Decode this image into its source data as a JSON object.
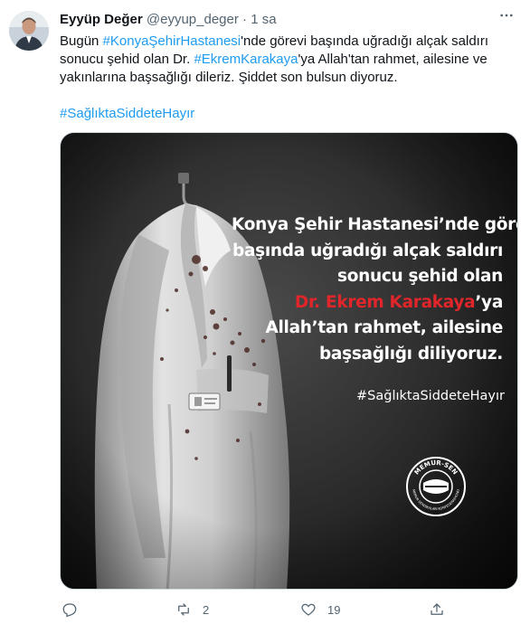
{
  "tweet": {
    "author_name": "Eyyüp Değer",
    "author_handle": "@eyyup_deger",
    "separator": "·",
    "time": "1 sa",
    "more_icon": "more-horizontal-icon",
    "text_segments": [
      {
        "text": "Bugün ",
        "type": "text"
      },
      {
        "text": "#KonyaŞehirHastanesi",
        "type": "hashtag"
      },
      {
        "text": "'nde görevi başında uğradığı alçak saldırı sonucu şehid olan Dr. ",
        "type": "text"
      },
      {
        "text": "#EkremKarakaya",
        "type": "hashtag"
      },
      {
        "text": "'ya Allah'tan rahmet, ailesine ve yakınlarına başsağlığı dileriz. Şiddet son bulsun diyoruz.",
        "type": "text"
      }
    ],
    "hashtag_line": "#SağlıktaSiddeteHayır"
  },
  "image": {
    "lines": [
      "Konya Şehir Hastanesi’nde görevi",
      "başında uğradığı alçak saldırı",
      "sonucu şehid olan"
    ],
    "line_highlight_name": "Dr. Ekrem Karakaya",
    "line_highlight_suffix": "’ya",
    "line_5": "Allah’tan rahmet, ailesine",
    "line_6": "başsağlığı diliyoruz.",
    "hashtag": "#SağlıktaSiddeteHayır",
    "logo_text": "MEMUR-SEN",
    "logo_subtext": "MEMUR SENDİKALARI KONFEDERASYONU",
    "accent_red": "#e0262a"
  },
  "actions": {
    "reply_icon": "reply-icon",
    "reply_count": "",
    "retweet_icon": "retweet-icon",
    "retweet_count": "2",
    "like_icon": "heart-icon",
    "like_count": "19",
    "share_icon": "share-icon"
  },
  "colors": {
    "link": "#1d9bf0",
    "secondary_text": "#536471",
    "primary_text": "#0f1419"
  }
}
